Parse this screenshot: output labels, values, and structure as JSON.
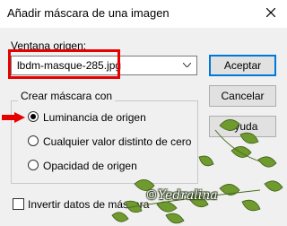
{
  "window": {
    "title": "Añadir máscara de una imagen",
    "close_icon": "close-icon"
  },
  "source": {
    "label": "Ventana origen:",
    "selected_value": "lbdm-masque-285.jpg"
  },
  "buttons": {
    "accept": "Aceptar",
    "cancel": "Cancelar",
    "help": "Ayuda"
  },
  "mask_group": {
    "title": "Crear máscara con",
    "options": [
      {
        "label": "Luminancia de origen",
        "checked": true
      },
      {
        "label": "Cualquier valor distinto de cero",
        "checked": false
      },
      {
        "label": "Opacidad de origen",
        "checked": false
      }
    ]
  },
  "invert": {
    "label": "Invertir datos de máscara",
    "checked": false
  },
  "watermark": {
    "text": "©Yedralina"
  },
  "colors": {
    "accent": "#0078d7",
    "highlight": "#e60000",
    "dialog_bg": "#f0f0f0"
  }
}
